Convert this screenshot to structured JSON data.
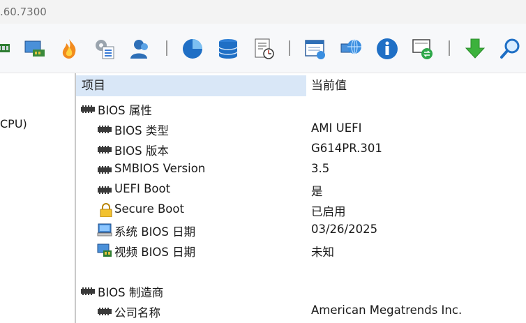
{
  "window": {
    "title": ".60.7300"
  },
  "toolbar": {
    "icons": [
      "memory-icon",
      "network-card-icon",
      "flame-icon",
      "settings-checklist-icon",
      "user-icon",
      "disk-pie-icon",
      "database-icon",
      "report-clock-icon",
      "browser-window-icon",
      "network-globe-icon",
      "info-icon",
      "remote-desktop-icon",
      "download-arrow-icon",
      "search-icon"
    ]
  },
  "left_pane": {
    "partial_text": "CPU)"
  },
  "table": {
    "headers": {
      "item": "项目",
      "value": "当前值"
    },
    "rows": [
      {
        "label": "BIOS 属性",
        "value": "",
        "icon": "chip-icon",
        "level": 0
      },
      {
        "label": "BIOS 类型",
        "value": "AMI UEFI",
        "icon": "chip-icon",
        "level": 1
      },
      {
        "label": "BIOS 版本",
        "value": "G614PR.301",
        "icon": "chip-icon",
        "level": 1
      },
      {
        "label": "SMBIOS Version",
        "value": "3.5",
        "icon": "chip-icon",
        "level": 1
      },
      {
        "label": "UEFI Boot",
        "value": "是",
        "icon": "chip-icon",
        "level": 1
      },
      {
        "label": "Secure Boot",
        "value": "已启用",
        "icon": "lock-icon",
        "level": 1
      },
      {
        "label": "系统 BIOS 日期",
        "value": "03/26/2025",
        "icon": "computer-icon",
        "level": 1
      },
      {
        "label": "视频 BIOS 日期",
        "value": "未知",
        "icon": "video-card-icon",
        "level": 1
      },
      {
        "label": "BIOS 制造商",
        "value": "",
        "icon": "chip-icon",
        "level": 0
      },
      {
        "label": "公司名称",
        "value": "American Megatrends Inc.",
        "icon": "chip-icon",
        "level": 1
      }
    ]
  }
}
